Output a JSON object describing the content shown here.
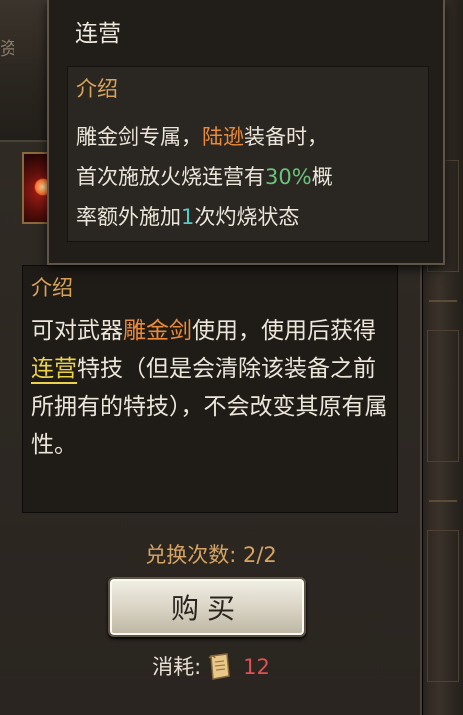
{
  "background": {
    "left_fragment": "资"
  },
  "tooltip": {
    "title": "连营",
    "section_label": "介绍",
    "line1": {
      "pre": "雕金剑专属，",
      "hero": "陆逊",
      "post": "装备时，"
    },
    "line2": {
      "pre": "首次施放火烧连营有",
      "chance": "30%",
      "post": "概"
    },
    "line3": {
      "pre": "率额外施加",
      "count": "1",
      "post": "次灼烧状态"
    }
  },
  "item": {
    "section_label": "介绍",
    "desc": {
      "t1": "可对武器",
      "weapon": "雕金剑",
      "t2": "使用，使用后获得",
      "skill": "连营",
      "t3": "特技（但是会清除该装备之前所拥有的特技），不会改变其原有属性。"
    },
    "exchange_text": "兑换次数: 2/2",
    "buy_label": "购买",
    "cost_label": "消耗:",
    "cost_value": "12",
    "cost_icon": "scroll-icon"
  },
  "colors": {
    "orange_highlight": "#ea8a3a",
    "yellow_highlight": "#ead24b",
    "green_highlight": "#6cc27a",
    "cost_red": "#e05050"
  }
}
